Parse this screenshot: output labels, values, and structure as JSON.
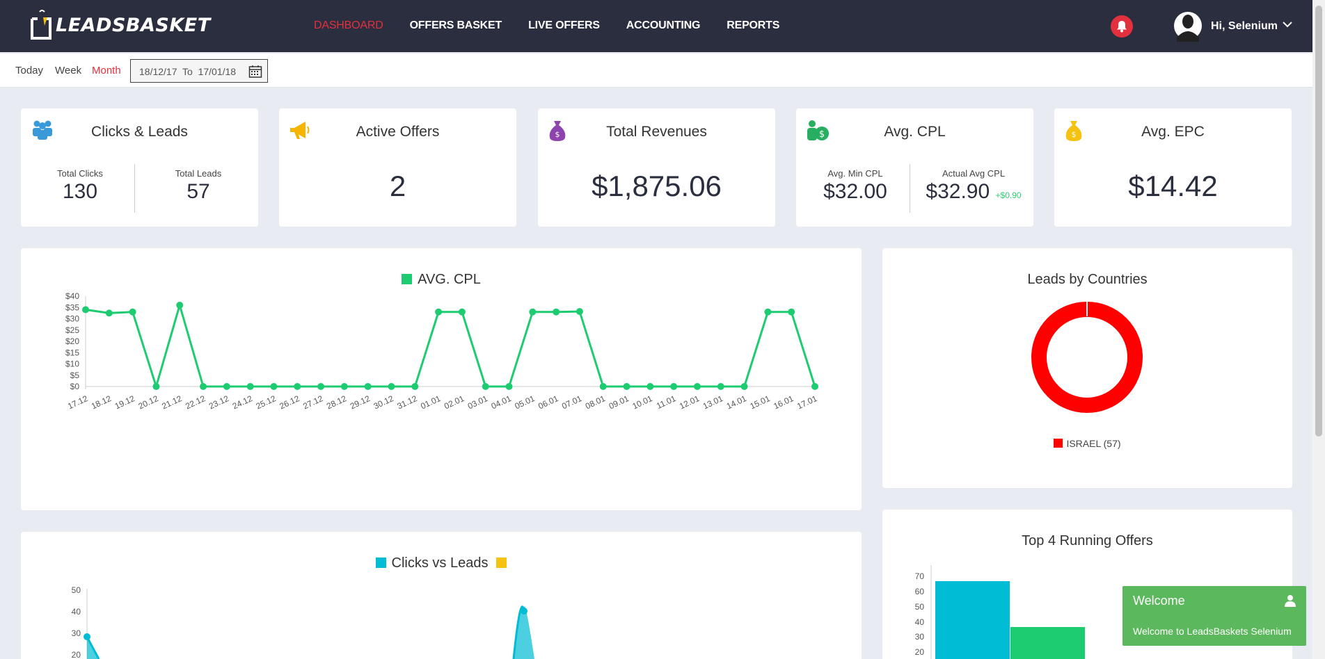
{
  "brand": {
    "name": "LEADSBASKET"
  },
  "nav": {
    "items": [
      {
        "label": "DASHBOARD",
        "active": true
      },
      {
        "label": "OFFERS BASKET",
        "active": false
      },
      {
        "label": "LIVE OFFERS",
        "active": false
      },
      {
        "label": "ACCOUNTING",
        "active": false
      },
      {
        "label": "REPORTS",
        "active": false
      }
    ],
    "user_greeting": "Hi, Selenium"
  },
  "date_filter": {
    "today": "Today",
    "week": "Week",
    "month": "Month",
    "active": "Month",
    "range_text": "18/12/17  To  17/01/18"
  },
  "stats": {
    "clicks_leads": {
      "title": "Clicks & Leads",
      "clicks_label": "Total Clicks",
      "clicks": "130",
      "leads_label": "Total Leads",
      "leads": "57"
    },
    "active_offers": {
      "title": "Active Offers",
      "value": "2"
    },
    "total_revenues": {
      "title": "Total Revenues",
      "value": "$1,875.06"
    },
    "avg_cpl": {
      "title": "Avg. CPL",
      "min_label": "Avg. Min CPL",
      "min_value": "$32.00",
      "actual_label": "Actual Avg CPL",
      "actual_value": "$32.90",
      "delta": "+$0.90"
    },
    "avg_epc": {
      "title": "Avg. EPC",
      "value": "$14.42"
    }
  },
  "colors": {
    "accent": "#e2303f",
    "navbar": "#2b2e3e",
    "green": "#1dcc70",
    "cyan": "#00bcd4",
    "yellow": "#f5c211",
    "red": "#ff0000",
    "toast": "#5cb85c"
  },
  "chart_data": [
    {
      "type": "line",
      "title": "AVG. CPL",
      "series": [
        {
          "name": "AVG. CPL",
          "color": "#1dcc70",
          "values": [
            34,
            32.5,
            33,
            0,
            36,
            0,
            0,
            0,
            0,
            0,
            0,
            0,
            0,
            0,
            0,
            33,
            33,
            0,
            0,
            33,
            33,
            33.2,
            0,
            0,
            0,
            0,
            0,
            0,
            0,
            33,
            33,
            0
          ]
        }
      ],
      "categories": [
        "17.12",
        "18.12",
        "19.12",
        "20.12",
        "21.12",
        "22.12",
        "23.12",
        "24.12",
        "25.12",
        "26.12",
        "27.12",
        "28.12",
        "29.12",
        "30.12",
        "31.12",
        "01.01",
        "02.01",
        "03.01",
        "04.01",
        "05.01",
        "06.01",
        "07.01",
        "08.01",
        "09.01",
        "10.01",
        "11.01",
        "12.01",
        "13.01",
        "14.01",
        "15.01",
        "16.01",
        "17.01"
      ],
      "y_ticks": [
        "$0",
        "$5",
        "$10",
        "$15",
        "$20",
        "$25",
        "$30",
        "$35",
        "$40"
      ],
      "ylim": [
        0,
        40
      ]
    },
    {
      "type": "pie",
      "title": "Leads by Countries",
      "slices": [
        {
          "label": "ISRAEL (57)",
          "value": 57,
          "color": "#ff0000"
        }
      ]
    },
    {
      "type": "area",
      "title": "Clicks vs Leads",
      "series": [
        {
          "name": "",
          "color": "#00bcd4"
        },
        {
          "name": "",
          "color": "#f5c211"
        }
      ],
      "y_ticks": [
        "20",
        "30",
        "40",
        "50"
      ],
      "visible_points": [
        {
          "x": 0,
          "y": 29
        },
        {
          "x": 19,
          "y": 41
        }
      ]
    },
    {
      "type": "bar",
      "title": "Top 4 Running Offers",
      "y_ticks": [
        "20",
        "30",
        "40",
        "50",
        "60",
        "70"
      ],
      "ylim": [
        10,
        70
      ],
      "values": [
        63,
        33
      ],
      "bar_colors": [
        "#00bcd4",
        "#1dcc70"
      ]
    }
  ],
  "toast": {
    "title": "Welcome",
    "message": "Welcome to LeadsBaskets Selenium"
  }
}
